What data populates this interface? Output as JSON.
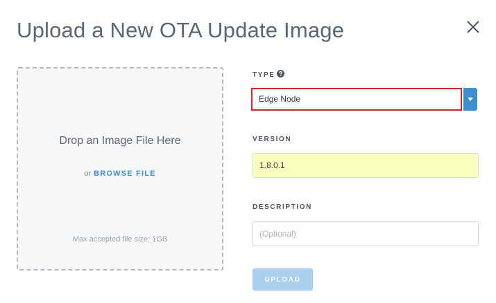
{
  "dialog": {
    "title": "Upload a New OTA Update Image",
    "close_icon": "close-icon"
  },
  "dropzone": {
    "drop_text": "Drop an Image File Here",
    "or_text": "or",
    "browse_label": "BROWSE FILE",
    "max_size_text": "Max accepted file size: 1GB"
  },
  "form": {
    "type": {
      "label": "TYPE",
      "help_icon": "question-circle-icon",
      "selected_value": "Edge Node",
      "arrow_icon": "caret-down-icon"
    },
    "version": {
      "label": "VERSION",
      "value": "1.8.0.1"
    },
    "description": {
      "label": "DESCRIPTION",
      "value": "",
      "placeholder": "(Optional)"
    },
    "upload_label": "UPLOAD"
  },
  "colors": {
    "accent": "#3f8fd0",
    "highlight_border": "#d9222a",
    "autofill_background": "#fbffbd",
    "upload_disabled": "#a9cfee"
  }
}
